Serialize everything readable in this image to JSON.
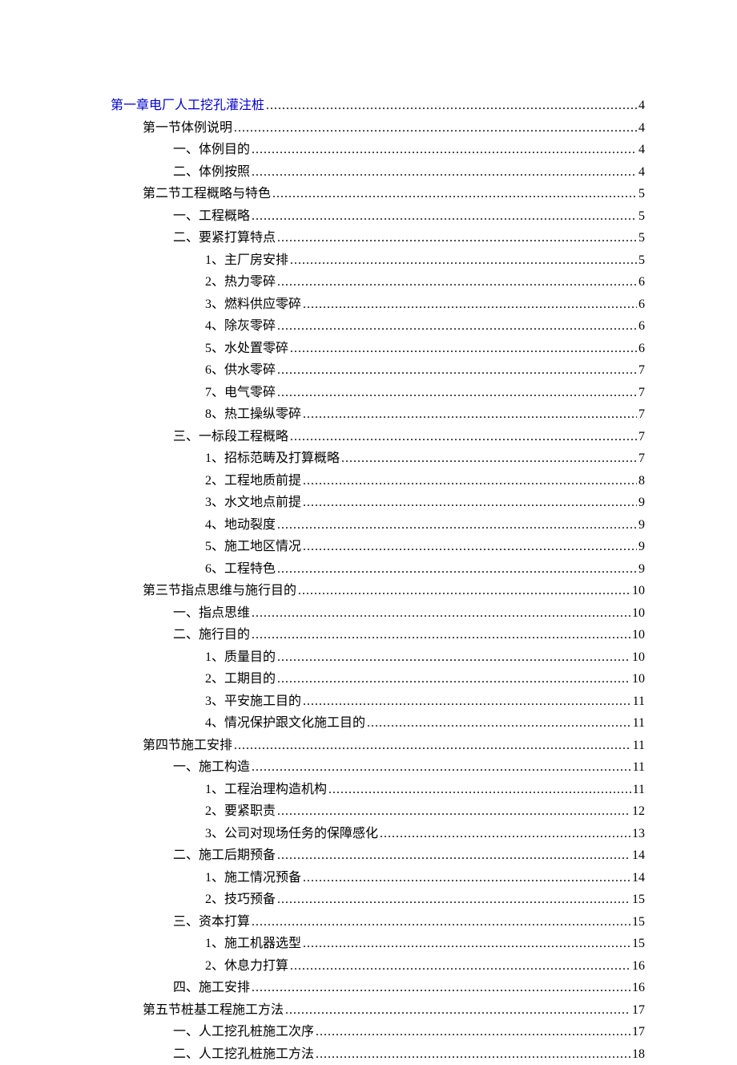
{
  "toc": [
    {
      "level": 0,
      "text": "第一章电厂人工挖孔灌注桩",
      "page": "4",
      "link": true
    },
    {
      "level": 1,
      "text": "第一节体例说明",
      "page": "4",
      "link": false
    },
    {
      "level": 2,
      "text": "一、体例目的",
      "page": "4",
      "link": false
    },
    {
      "level": 2,
      "text": "二、体例按照",
      "page": "4",
      "link": false
    },
    {
      "level": 1,
      "text": "第二节工程概略与特色",
      "page": "5",
      "link": false
    },
    {
      "level": 2,
      "text": "一、工程概略",
      "page": "5",
      "link": false
    },
    {
      "level": 2,
      "text": "二、要紧打算特点",
      "page": "5",
      "link": false
    },
    {
      "level": 3,
      "text": "1、主厂房安排",
      "page": "5",
      "link": false
    },
    {
      "level": 3,
      "text": "2、热力零碎",
      "page": "6",
      "link": false
    },
    {
      "level": 3,
      "text": "3、燃料供应零碎",
      "page": "6",
      "link": false
    },
    {
      "level": 3,
      "text": "4、除灰零碎",
      "page": "6",
      "link": false
    },
    {
      "level": 3,
      "text": "5、水处置零碎",
      "page": "6",
      "link": false
    },
    {
      "level": 3,
      "text": "6、供水零碎",
      "page": "7",
      "link": false
    },
    {
      "level": 3,
      "text": "7、电气零碎",
      "page": "7",
      "link": false
    },
    {
      "level": 3,
      "text": "8、热工操纵零碎",
      "page": "7",
      "link": false
    },
    {
      "level": 2,
      "text": "三、一标段工程概略",
      "page": "7",
      "link": false
    },
    {
      "level": 3,
      "text": "1、招标范畴及打算概略",
      "page": "7",
      "link": false
    },
    {
      "level": 3,
      "text": "2、工程地质前提",
      "page": "8",
      "link": false
    },
    {
      "level": 3,
      "text": "3、水文地点前提",
      "page": "9",
      "link": false
    },
    {
      "level": 3,
      "text": "4、地动裂度",
      "page": "9",
      "link": false
    },
    {
      "level": 3,
      "text": "5、施工地区情况",
      "page": "9",
      "link": false
    },
    {
      "level": 3,
      "text": "6、工程特色",
      "page": "9",
      "link": false
    },
    {
      "level": 1,
      "text": "第三节指点思维与施行目的",
      "page": "10",
      "link": false
    },
    {
      "level": 2,
      "text": "一、指点思维",
      "page": "10",
      "link": false
    },
    {
      "level": 2,
      "text": "二、施行目的",
      "page": "10",
      "link": false
    },
    {
      "level": 3,
      "text": "1、质量目的",
      "page": "10",
      "link": false
    },
    {
      "level": 3,
      "text": "2、工期目的",
      "page": "10",
      "link": false
    },
    {
      "level": 3,
      "text": "3、平安施工目的",
      "page": "11",
      "link": false
    },
    {
      "level": 3,
      "text": "4、情况保护跟文化施工目的",
      "page": "11",
      "link": false
    },
    {
      "level": 1,
      "text": "第四节施工安排",
      "page": "11",
      "link": false
    },
    {
      "level": 2,
      "text": "一、施工构造",
      "page": "11",
      "link": false
    },
    {
      "level": 3,
      "text": "1、工程治理构造机构",
      "page": "11",
      "link": false
    },
    {
      "level": 3,
      "text": "2、要紧职责",
      "page": "12",
      "link": false
    },
    {
      "level": 3,
      "text": "3、公司对现场任务的保障感化",
      "page": "13",
      "link": false
    },
    {
      "level": 2,
      "text": "二、施工后期预备",
      "page": "14",
      "link": false
    },
    {
      "level": 3,
      "text": "1、施工情况预备",
      "page": "14",
      "link": false
    },
    {
      "level": 3,
      "text": "2、技巧预备",
      "page": "15",
      "link": false
    },
    {
      "level": 2,
      "text": "三、资本打算",
      "page": "15",
      "link": false
    },
    {
      "level": 3,
      "text": "1、施工机器选型",
      "page": "15",
      "link": false
    },
    {
      "level": 3,
      "text": "2、休息力打算",
      "page": "16",
      "link": false
    },
    {
      "level": 2,
      "text": "四、施工安排",
      "page": "16",
      "link": false
    },
    {
      "level": 1,
      "text": "第五节桩基工程施工方法",
      "page": "17",
      "link": false
    },
    {
      "level": 2,
      "text": "一、人工挖孔桩施工次序",
      "page": "17",
      "link": false
    },
    {
      "level": 2,
      "text": "二、人工挖孔桩施工方法",
      "page": "18",
      "link": false
    }
  ]
}
